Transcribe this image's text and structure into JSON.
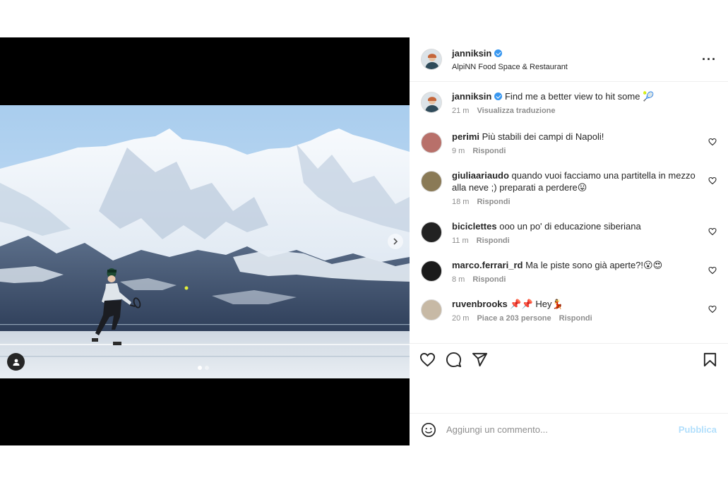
{
  "post": {
    "author": "janniksin",
    "location": "AlpiNN Food Space & Restaurant",
    "verified": true
  },
  "caption": {
    "username": "janniksin",
    "text": "Find me a better view to hit some 🎾",
    "time": "21 m",
    "translate": "Visualizza traduzione"
  },
  "comments": [
    {
      "username": "perimi",
      "text": "Più stabili dei campi di Napoli!",
      "time": "9 m",
      "likes": "",
      "reply": "Rispondi",
      "avatar_color": "#b8706a"
    },
    {
      "username": "giuliaariaudo",
      "text": "quando vuoi facciamo una partitella in mezzo alla neve ;) preparati a perdere😛",
      "time": "18 m",
      "likes": "",
      "reply": "Rispondi",
      "avatar_color": "#8a7a56"
    },
    {
      "username": "biciclettes",
      "text": "ooo un po' di educazione siberiana",
      "time": "11 m",
      "likes": "",
      "reply": "Rispondi",
      "avatar_color": "#222222"
    },
    {
      "username": "marco.ferrari_rd",
      "text": "Ma le piste sono già aperte?!😮😍",
      "time": "8 m",
      "likes": "",
      "reply": "Rispondi",
      "avatar_color": "#1a1a1a"
    },
    {
      "username": "ruvenbrooks",
      "text": "📌📌 Hey💃",
      "time": "20 m",
      "likes": "Piace a 203 persone",
      "reply": "Rispondi",
      "avatar_color": "#c7b9a5"
    }
  ],
  "composer": {
    "placeholder": "Aggiungi un commento...",
    "publish": "Pubblica"
  },
  "colors": {
    "verified": "#3897f0",
    "publish_disabled": "#b2dffc"
  }
}
